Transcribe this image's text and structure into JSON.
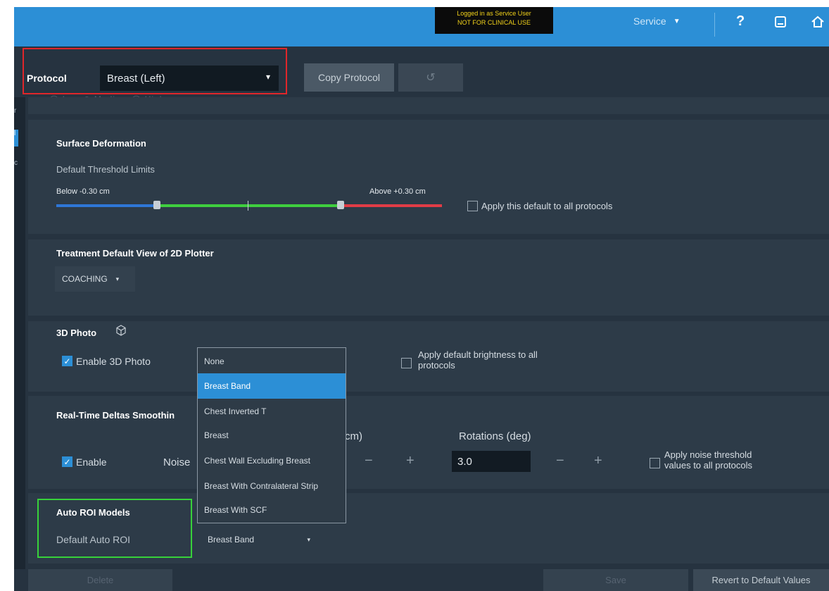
{
  "header": {
    "login_line1": "Logged in as Service User",
    "login_line2": "NOT FOR CLINICAL USE",
    "service_label": "Service",
    "help_icon": "?",
    "window_icon": "window-icon",
    "home_icon": "home-icon"
  },
  "left_strip": {
    "tag_1": "r",
    "tag_2": "l",
    "tag_3": "c"
  },
  "protocol": {
    "label": "Protocol",
    "selected": "Breast (Left)",
    "copy_button": "Copy Protocol",
    "undo_icon": "undo-icon",
    "ghost_radios": "◯ Low   ◉ Medium   ◯ High"
  },
  "surface_deformation": {
    "title": "Surface Deformation",
    "subtitle": "Default Threshold Limits",
    "below_label": "Below -0.30 cm",
    "above_label": "Above +0.30 cm",
    "apply_all": "Apply this default to all protocols",
    "apply_all_checked": false,
    "colors": {
      "below": "#2e76d6",
      "within": "#3fcf3f",
      "above": "#e13c46"
    }
  },
  "plotter_view": {
    "title": "Treatment Default View of 2D Plotter",
    "selected": "COACHING"
  },
  "photo_3d": {
    "title": "3D Photo",
    "enable_label": "Enable 3D Photo",
    "enable_checked": true,
    "apply_brightness_line1": "Apply default brightness to all",
    "apply_brightness_line2": "protocols",
    "apply_brightness_checked": false
  },
  "deltas": {
    "title": "Real-Time Deltas Smoothin",
    "enable_label": "Enable",
    "enable_checked": true,
    "noise_label": "Noise",
    "translations_unit": "cm)",
    "rotations_label": "Rotations (deg)",
    "rotations_value": "3.0",
    "minus": "−",
    "plus": "+",
    "apply_noise_line1": "Apply noise threshold",
    "apply_noise_line2": "values to all protocols",
    "apply_noise_checked": false
  },
  "auto_roi": {
    "title": "Auto ROI Models",
    "default_label": "Default Auto ROI",
    "selected": "Breast Band",
    "options": [
      "None",
      "Breast Band",
      "Chest Inverted T",
      "Breast",
      "Chest Wall Excluding Breast",
      "Breast With Contralateral Strip",
      "Breast With SCF"
    ],
    "highlighted_index": 1
  },
  "footer": {
    "delete": "Delete",
    "save": "Save",
    "revert": "Revert to Default Values"
  }
}
